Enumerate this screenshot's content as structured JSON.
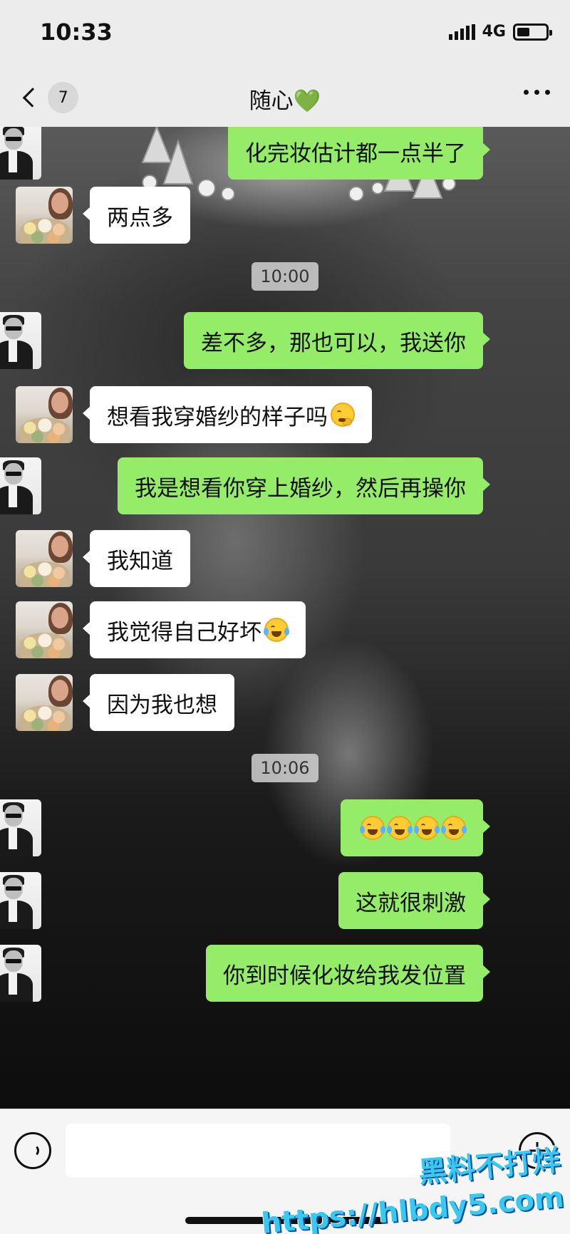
{
  "status": {
    "time": "10:33",
    "network": "4G",
    "battery_level": 0.45
  },
  "header": {
    "unread_count": "7",
    "title": "随心💚"
  },
  "timestamps": [
    "10:00",
    "10:06"
  ],
  "messages": [
    {
      "side": "right",
      "text": "化完妆估计都一点半了"
    },
    {
      "side": "left",
      "text": "两点多"
    },
    {
      "side": "right",
      "text": "差不多，那也可以，我送你"
    },
    {
      "side": "left",
      "text": "想看我穿婚纱的样子吗",
      "emoji": "thinking-face"
    },
    {
      "side": "right",
      "text": "我是想看你穿上婚纱，然后再操你"
    },
    {
      "side": "left",
      "text": "我知道"
    },
    {
      "side": "left",
      "text": "我觉得自己好坏",
      "emoji": "rolling-laughing-face"
    },
    {
      "side": "left",
      "text": "因为我也想"
    },
    {
      "side": "right",
      "text": "",
      "emoji_count": 4,
      "emoji": "tears-of-joy-face"
    },
    {
      "side": "right",
      "text": "这就很刺激"
    },
    {
      "side": "right",
      "text": "你到时候化妆给我发位置"
    }
  ],
  "input": {
    "value": ""
  },
  "watermark": {
    "line1": "黑料不打烊",
    "line2": "https://hlbdy5.com"
  },
  "colors": {
    "sent_bubble": "#95ec69",
    "received_bubble": "#ffffff",
    "watermark": "#38c8f0"
  }
}
